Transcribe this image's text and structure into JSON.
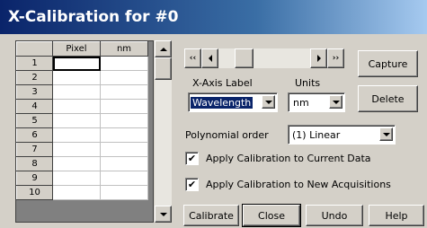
{
  "window": {
    "title": "X-Calibration for #0"
  },
  "table": {
    "headers": [
      "Pixel",
      "nm"
    ],
    "rows": [
      "1",
      "2",
      "3",
      "4",
      "5",
      "6",
      "7",
      "8",
      "9",
      "10"
    ]
  },
  "nav": {
    "first_label": "|<<",
    "prev_label": "<",
    "next_label": ">",
    "last_label": ">>|",
    "first_glyph": "‹‹",
    "last_glyph": "››"
  },
  "buttons": {
    "capture": "Capture",
    "delete": "Delete",
    "calibrate": "Calibrate",
    "close": "Close",
    "undo": "Undo",
    "help": "Help"
  },
  "fields": {
    "x_axis_label": {
      "label": "X-Axis Label",
      "value": "Wavelength"
    },
    "units": {
      "label": "Units",
      "value": "nm"
    },
    "polynomial_order": {
      "label": "Polynomial order",
      "value": "(1) Linear"
    }
  },
  "options": {
    "apply_current": {
      "label": "Apply Calibration to Current Data",
      "checked": true
    },
    "apply_new": {
      "label": "Apply Calibration to New Acquisitions",
      "checked": true
    }
  },
  "colors": {
    "title_bar": "#0a246a",
    "face": "#d4d0c8",
    "selection": "#0a246a"
  }
}
